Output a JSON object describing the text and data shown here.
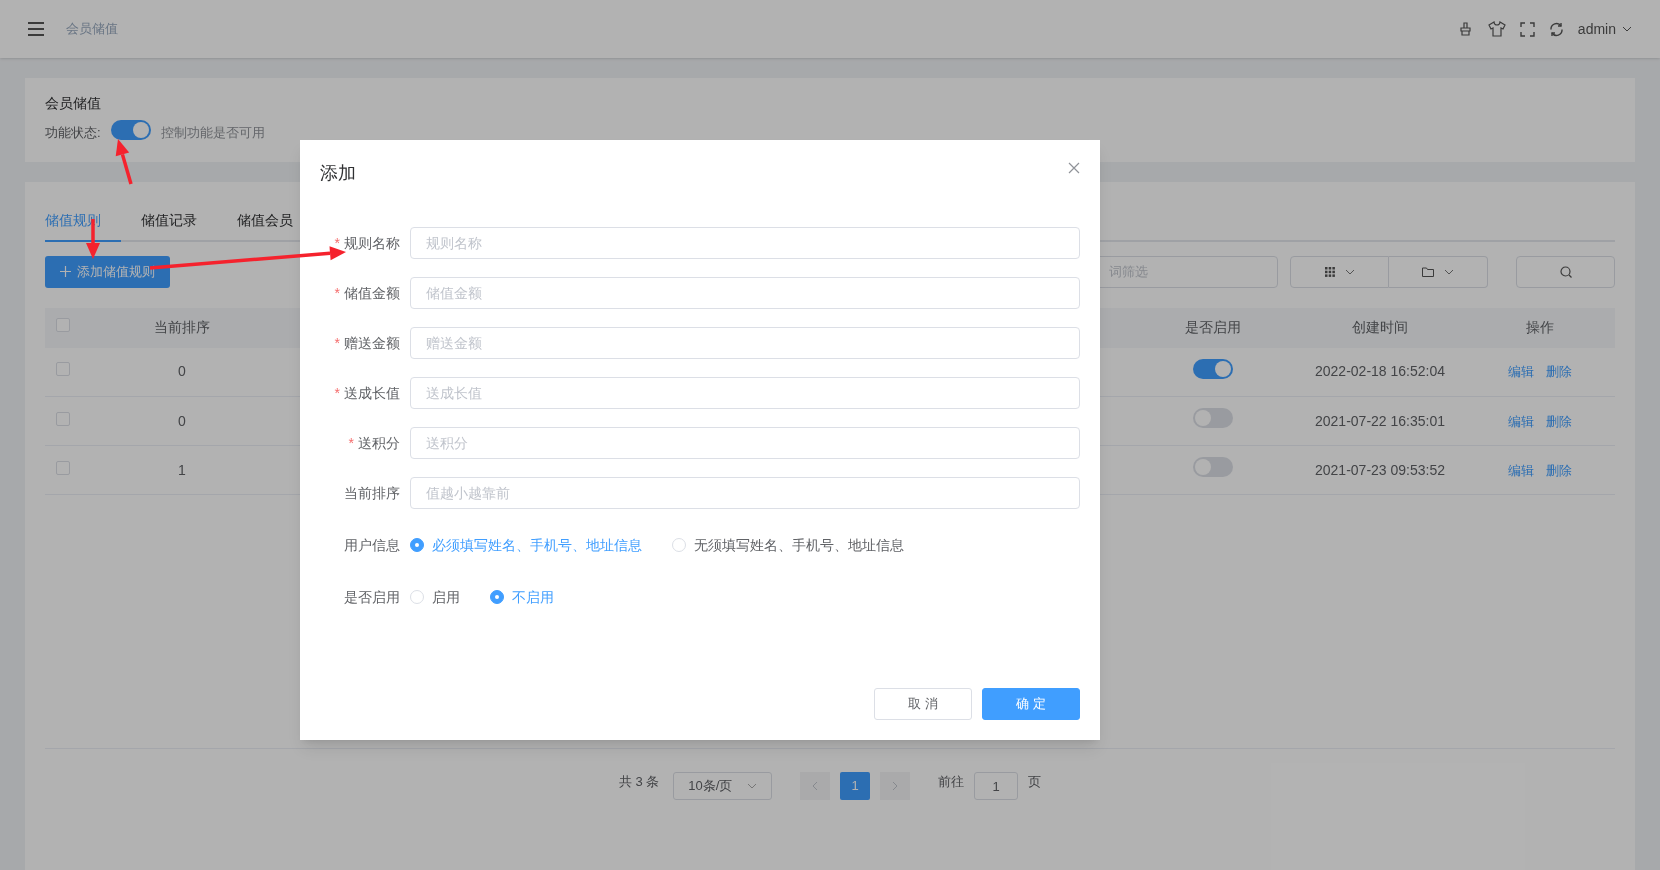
{
  "header": {
    "breadcrumb": "会员储值",
    "user": "admin"
  },
  "feature_card": {
    "title": "会员储值",
    "status_label": "功能状态:",
    "status_on": true,
    "hint": "控制功能是否可用"
  },
  "tabs": [
    {
      "label": "储值规则",
      "selected": true
    },
    {
      "label": "储值记录",
      "selected": false
    },
    {
      "label": "储值会员",
      "selected": false
    }
  ],
  "add_button": "添加储值规则",
  "filter": {
    "placeholder": "词筛选"
  },
  "table": {
    "header_checked": false,
    "columns": [
      "当前排序",
      "是否启用",
      "创建时间",
      "操作"
    ],
    "rows": [
      {
        "checked": false,
        "sort": "0",
        "enabled": true,
        "created": "2022-02-18 16:52:04",
        "actions": [
          "编辑",
          "删除"
        ]
      },
      {
        "checked": false,
        "sort": "0",
        "enabled": false,
        "created": "2021-07-22 16:35:01",
        "actions": [
          "编辑",
          "删除"
        ]
      },
      {
        "checked": false,
        "sort": "1",
        "enabled": false,
        "created": "2021-07-23 09:53:52",
        "actions": [
          "编辑",
          "删除"
        ]
      }
    ]
  },
  "pagination": {
    "total": "共 3 条",
    "page_size": "10条/页",
    "pages": [
      {
        "label": "1",
        "selected": true
      }
    ],
    "goto_label": "前往",
    "goto_value": "1",
    "goto_suffix": "页"
  },
  "dialog": {
    "title": "添加",
    "required_mark": "*",
    "fields": [
      {
        "label": "规则名称",
        "required": true,
        "placeholder": "规则名称"
      },
      {
        "label": "储值金额",
        "required": true,
        "placeholder": "储值金额"
      },
      {
        "label": "赠送金额",
        "required": true,
        "placeholder": "赠送金额"
      },
      {
        "label": "送成长值",
        "required": true,
        "placeholder": "送成长值"
      },
      {
        "label": "送积分",
        "required": true,
        "placeholder": "送积分"
      },
      {
        "label": "当前排序",
        "required": false,
        "placeholder": "值越小越靠前"
      }
    ],
    "radio_groups": [
      {
        "label": "用户信息",
        "options": [
          {
            "label": "必须填写姓名、手机号、地址信息",
            "selected": true
          },
          {
            "label": "无须填写姓名、手机号、地址信息",
            "selected": false
          }
        ]
      },
      {
        "label": "是否启用",
        "options": [
          {
            "label": "启用",
            "selected": false
          },
          {
            "label": "不启用",
            "selected": true
          }
        ]
      }
    ],
    "buttons": [
      {
        "label": "取 消",
        "kind": "default"
      },
      {
        "label": "确 定",
        "kind": "primary"
      }
    ]
  }
}
